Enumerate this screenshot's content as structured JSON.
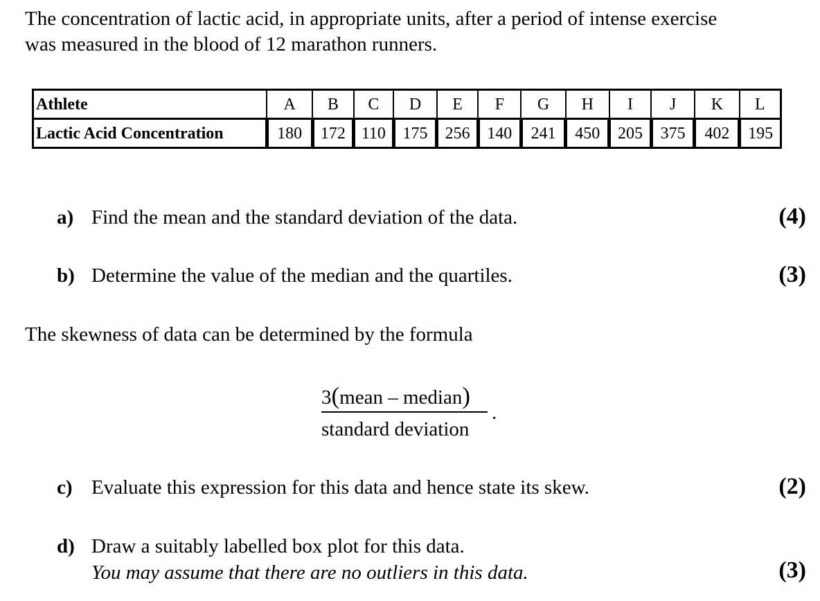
{
  "intro": {
    "line1": "The concentration of lactic acid, in appropriate units, after a period of intense exercise",
    "line2": "was measured in the blood of 12  marathon runners."
  },
  "table": {
    "row1_header": "Athlete",
    "row2_header": "Lactic Acid Concentration",
    "athletes": [
      "A",
      "B",
      "C",
      "D",
      "E",
      "F",
      "G",
      "H",
      "I",
      "J",
      "K",
      "L"
    ],
    "values": [
      "180",
      "172",
      "110",
      "175",
      "256",
      "140",
      "241",
      "450",
      "205",
      "375",
      "402",
      "195"
    ]
  },
  "questions": {
    "a": {
      "letter": "a)",
      "text": "Find the mean and the standard deviation of the data.",
      "marks": "(4)"
    },
    "b": {
      "letter": "b)",
      "text": "Determine the value of the median and the quartiles.",
      "marks": "(3)"
    },
    "c": {
      "letter": "c)",
      "text": "Evaluate this expression for this data and hence state its skew.",
      "marks": "(2)"
    },
    "d": {
      "letter": "d)",
      "text": "Draw a suitably labelled box plot for this data.",
      "note": "You may assume that there are no outliers in this data.",
      "marks": "(3)"
    }
  },
  "skew_intro": "The skewness of data can be determined by the formula",
  "formula": {
    "coefficient": "3",
    "open_paren": "(",
    "numerator": "mean – median",
    "close_paren": ")",
    "denominator": "standard deviation",
    "end_punct": "."
  }
}
